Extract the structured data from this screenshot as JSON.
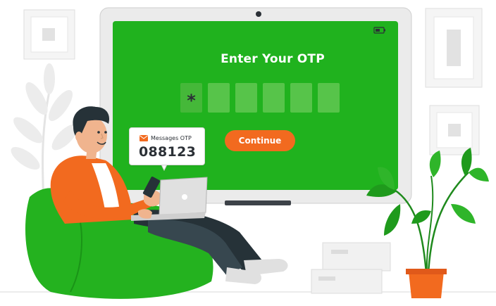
{
  "screen": {
    "title": "Enter Your OTP",
    "otp_digits": [
      "*",
      "",
      "",
      "",
      "",
      ""
    ],
    "continue_label": "Continue"
  },
  "notification": {
    "app_label": "Messages OTP",
    "code": "088123"
  },
  "colors": {
    "screen_green": "#20b21e",
    "field_green": "#57c44a",
    "button_orange": "#f26a1f",
    "dark_text": "#2b3036"
  },
  "icons": [
    "mail-icon",
    "battery-icon",
    "camera-icon",
    "phone-icon",
    "laptop-icon"
  ]
}
